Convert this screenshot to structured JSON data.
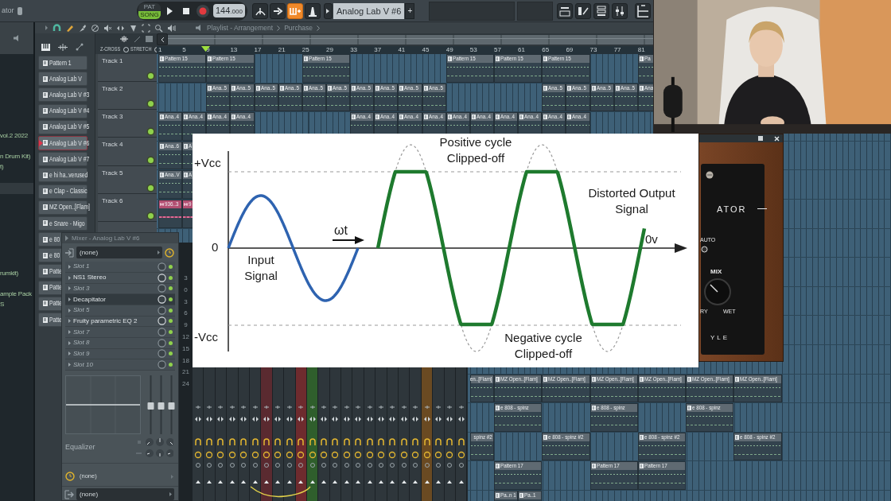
{
  "toolbar": {
    "panel_label": "ator",
    "mode": [
      {
        "label": "PAT",
        "selected": false
      },
      {
        "label": "SONG",
        "selected": true
      }
    ],
    "tempo": "144",
    "tempo_fraction": ".000",
    "buttons": [
      {
        "kind": "blend",
        "on": false
      },
      {
        "kind": "arrow",
        "on": false
      },
      {
        "kind": "typing",
        "on": true
      },
      {
        "kind": "metronome",
        "on": false
      }
    ],
    "pattern": "Analog Lab V #6",
    "add_label": "+"
  },
  "browser": {
    "groups": [
      [
        "vol.2 2022",
        "n Drum Kit)",
        "t)"
      ],
      [
        "rumkit)",
        "ample Pack",
        "S"
      ]
    ]
  },
  "playlist": {
    "breadcrumbs": [
      "Playlist - Arrangement",
      "Purchase"
    ],
    "stretch_labels": [
      "Z-CROSS",
      "STRETCH"
    ],
    "ruler": [
      "1",
      "5",
      "9",
      "13",
      "17",
      "21",
      "25",
      "29",
      "33",
      "37",
      "41",
      "45",
      "49",
      "53",
      "57",
      "61",
      "65",
      "69",
      "73",
      "77",
      "81"
    ]
  },
  "channels": [
    {
      "label": "Pattern 1",
      "selected": false
    },
    {
      "label": "Analog Lab V",
      "selected": false
    },
    {
      "label": "Analog Lab V #3",
      "selected": false
    },
    {
      "label": "Analog Lab V #4",
      "selected": false
    },
    {
      "label": "Analog Lab V #5",
      "selected": false
    },
    {
      "label": "Analog Lab V #6",
      "selected": true
    },
    {
      "label": "Analog Lab V #7",
      "selected": false
    },
    {
      "label": "e hi ha..verused",
      "selected": false
    },
    {
      "label": "e Clap - Classic",
      "selected": false
    },
    {
      "label": "MZ Open..[Flam]",
      "selected": false
    },
    {
      "label": "e Snare - Migo",
      "selected": false
    },
    {
      "label": "e 80",
      "selected": false
    },
    {
      "label": "e 80",
      "selected": false
    },
    {
      "label": "Patte",
      "selected": false
    },
    {
      "label": "Patte",
      "selected": false
    },
    {
      "label": "Patte",
      "selected": false
    },
    {
      "label": "Patte",
      "selected": false
    }
  ],
  "tracks": [
    {
      "name": "Track 1",
      "enabled": true,
      "segments": [
        {
          "kind": "pattern",
          "label": "Pattern 15",
          "wide": true
        },
        {
          "kind": "pattern",
          "label": "Pattern 15",
          "wide": true
        },
        {
          "kind": "gap"
        },
        {
          "kind": "gap"
        },
        {
          "kind": "pattern",
          "label": "Pattern 15",
          "wide": true
        },
        {
          "kind": "gap"
        },
        {
          "kind": "gap"
        },
        {
          "kind": "gap"
        },
        {
          "kind": "gap"
        },
        {
          "kind": "pattern",
          "label": "Pattern 15",
          "wide": true
        },
        {
          "kind": "pattern",
          "label": "Pattern 15",
          "wide": true
        },
        {
          "kind": "pattern",
          "label": "Pattern 15",
          "wide": true
        },
        {
          "kind": "gap"
        },
        {
          "kind": "gap"
        },
        {
          "kind": "pattern",
          "label": "Pa",
          "wide": false
        }
      ]
    },
    {
      "name": "Track 2",
      "enabled": true,
      "segments": [
        {
          "kind": "gap"
        },
        {
          "kind": "gap"
        },
        {
          "kind": "pattern",
          "label": "Ana..5",
          "wide": false
        },
        {
          "kind": "pattern",
          "label": "Ana..5",
          "wide": false
        },
        {
          "kind": "pattern",
          "label": "Ana..5",
          "wide": false
        },
        {
          "kind": "pattern",
          "label": "Ana..5",
          "wide": false
        },
        {
          "kind": "pattern",
          "label": "Ana..5",
          "wide": false
        },
        {
          "kind": "pattern",
          "label": "Ana..5",
          "wide": false
        },
        {
          "kind": "pattern",
          "label": "Ana..5",
          "wide": false
        },
        {
          "kind": "pattern",
          "label": "Ana..5",
          "wide": false
        },
        {
          "kind": "pattern",
          "label": "Ana..5",
          "wide": false
        },
        {
          "kind": "pattern",
          "label": "Ana..5",
          "wide": false
        },
        {
          "kind": "gap"
        },
        {
          "kind": "gap"
        },
        {
          "kind": "gap"
        },
        {
          "kind": "gap"
        },
        {
          "kind": "pattern",
          "label": "Ana..5",
          "wide": false
        },
        {
          "kind": "pattern",
          "label": "Ana..5",
          "wide": false
        },
        {
          "kind": "pattern",
          "label": "Ana..5",
          "wide": false
        },
        {
          "kind": "pattern",
          "label": "Ana..5",
          "wide": false
        },
        {
          "kind": "pattern",
          "label": "Ana",
          "wide": false
        }
      ]
    },
    {
      "name": "Track 3",
      "enabled": true,
      "segments": [
        {
          "kind": "pattern",
          "label": "Ana..4",
          "wide": false
        },
        {
          "kind": "pattern",
          "label": "Ana..4",
          "wide": false
        },
        {
          "kind": "pattern",
          "label": "Ana..4",
          "wide": false
        },
        {
          "kind": "pattern",
          "label": "Ana..4",
          "wide": false
        },
        {
          "kind": "gap"
        },
        {
          "kind": "gap"
        },
        {
          "kind": "gap"
        },
        {
          "kind": "gap"
        },
        {
          "kind": "pattern",
          "label": "Ana..4",
          "wide": false
        },
        {
          "kind": "pattern",
          "label": "Ana..4",
          "wide": false
        },
        {
          "kind": "pattern",
          "label": "Ana..4",
          "wide": false
        },
        {
          "kind": "pattern",
          "label": "Ana..4",
          "wide": false
        },
        {
          "kind": "pattern",
          "label": "Ana..4",
          "wide": false
        },
        {
          "kind": "pattern",
          "label": "Ana..4",
          "wide": false
        },
        {
          "kind": "pattern",
          "label": "Ana..4",
          "wide": false
        },
        {
          "kind": "pattern",
          "label": "Ana..4",
          "wide": false
        },
        {
          "kind": "pattern",
          "label": "Ana..4",
          "wide": false
        },
        {
          "kind": "pattern",
          "label": "Ana..4",
          "wide": false
        }
      ]
    },
    {
      "name": "Track 4",
      "enabled": true,
      "segments": [
        {
          "kind": "pattern",
          "label": "Ana..6",
          "wide": false
        },
        {
          "kind": "pattern",
          "label": "A",
          "wide": false
        }
      ]
    },
    {
      "name": "Track 5",
      "enabled": true,
      "segments": [
        {
          "kind": "pattern",
          "label": "Ana..V",
          "wide": false
        },
        {
          "kind": "pattern",
          "label": "A",
          "wide": false
        }
      ]
    },
    {
      "name": "Track 6",
      "enabled": true,
      "segments": [
        {
          "kind": "audio",
          "label": "936..3",
          "wide": false
        },
        {
          "kind": "audio",
          "label": "9",
          "wide": false
        }
      ]
    }
  ],
  "lower_tracks": [
    {
      "segments": [
        {
          "kind": "gap"
        },
        {
          "kind": "gap"
        },
        {
          "kind": "gap"
        },
        {
          "kind": "gap"
        },
        {
          "kind": "gap"
        },
        {
          "kind": "gap"
        },
        {
          "kind": "gap"
        },
        {
          "kind": "gap"
        },
        {
          "kind": "gap"
        },
        {
          "kind": "gap"
        },
        {
          "kind": "gap"
        },
        {
          "kind": "gap"
        },
        {
          "kind": "gap"
        },
        {
          "kind": "cut",
          "label": "en..[Flam]",
          "wide": false
        },
        {
          "kind": "pattern",
          "label": "MZ Open..[Flam]",
          "wide": true
        },
        {
          "kind": "pattern",
          "label": "MZ Open..[Flam]",
          "wide": true
        },
        {
          "kind": "pattern",
          "label": "MZ Open..[Flam]",
          "wide": true
        },
        {
          "kind": "pattern",
          "label": "MZ Open..[Flam]",
          "wide": true
        },
        {
          "kind": "pattern",
          "label": "MZ Open..[Flam]",
          "wide": true
        },
        {
          "kind": "pattern",
          "label": "MZ Open..[Flam]",
          "wide": true
        }
      ]
    },
    {
      "segments": [
        {
          "kind": "gap"
        },
        {
          "kind": "gap"
        },
        {
          "kind": "gap"
        },
        {
          "kind": "gap"
        },
        {
          "kind": "gap"
        },
        {
          "kind": "gap"
        },
        {
          "kind": "gap"
        },
        {
          "kind": "gap"
        },
        {
          "kind": "gap"
        },
        {
          "kind": "gap"
        },
        {
          "kind": "gap"
        },
        {
          "kind": "gap"
        },
        {
          "kind": "gap"
        },
        {
          "kind": "gap"
        },
        {
          "kind": "pattern",
          "label": "e 808 - spinz",
          "wide": true
        },
        {
          "kind": "gap"
        },
        {
          "kind": "gap"
        },
        {
          "kind": "pattern",
          "label": "e 808 - spinz",
          "wide": true
        },
        {
          "kind": "gap"
        },
        {
          "kind": "gap"
        },
        {
          "kind": "pattern",
          "label": "e 808 - spinz",
          "wide": true
        }
      ]
    },
    {
      "segments": [
        {
          "kind": "gap"
        },
        {
          "kind": "gap"
        },
        {
          "kind": "gap"
        },
        {
          "kind": "gap"
        },
        {
          "kind": "gap"
        },
        {
          "kind": "gap"
        },
        {
          "kind": "gap"
        },
        {
          "kind": "gap"
        },
        {
          "kind": "gap"
        },
        {
          "kind": "gap"
        },
        {
          "kind": "gap"
        },
        {
          "kind": "gap"
        },
        {
          "kind": "gap"
        },
        {
          "kind": "cut",
          "label": "spinz #2",
          "wide": false
        },
        {
          "kind": "gap"
        },
        {
          "kind": "gap"
        },
        {
          "kind": "pattern",
          "label": "e 808 - spinz #2",
          "wide": true
        },
        {
          "kind": "gap"
        },
        {
          "kind": "gap"
        },
        {
          "kind": "pattern",
          "label": "e 808 - spinz #2",
          "wide": true
        },
        {
          "kind": "gap"
        },
        {
          "kind": "gap"
        },
        {
          "kind": "pattern",
          "label": "e 808 - spinz #2",
          "wide": true
        }
      ]
    },
    {
      "segments": [
        {
          "kind": "gap"
        },
        {
          "kind": "gap"
        },
        {
          "kind": "gap"
        },
        {
          "kind": "gap"
        },
        {
          "kind": "gap"
        },
        {
          "kind": "gap"
        },
        {
          "kind": "gap"
        },
        {
          "kind": "gap"
        },
        {
          "kind": "gap"
        },
        {
          "kind": "gap"
        },
        {
          "kind": "gap"
        },
        {
          "kind": "gap"
        },
        {
          "kind": "gap"
        },
        {
          "kind": "gap"
        },
        {
          "kind": "pattern",
          "label": "Pattern 17",
          "wide": true
        },
        {
          "kind": "gap"
        },
        {
          "kind": "gap"
        },
        {
          "kind": "pattern",
          "label": "Pattern 17",
          "wide": true
        },
        {
          "kind": "pattern",
          "label": "Pattern 17",
          "wide": true
        }
      ]
    },
    {
      "segments": [
        {
          "kind": "gap"
        },
        {
          "kind": "gap"
        },
        {
          "kind": "gap"
        },
        {
          "kind": "gap"
        },
        {
          "kind": "gap"
        },
        {
          "kind": "gap"
        },
        {
          "kind": "gap"
        },
        {
          "kind": "gap"
        },
        {
          "kind": "gap"
        },
        {
          "kind": "gap"
        },
        {
          "kind": "gap"
        },
        {
          "kind": "gap"
        },
        {
          "kind": "gap"
        },
        {
          "kind": "gap"
        },
        {
          "kind": "pattern",
          "label": "Pa..n 1",
          "wide": false
        },
        {
          "kind": "pattern",
          "label": "Pa..1",
          "wide": false
        }
      ]
    }
  ],
  "mixer": {
    "title": "Mixer - Analog Lab V #6",
    "input": "(none)",
    "slots": [
      {
        "label": "Slot 1",
        "empty": true,
        "selected": false,
        "on": true
      },
      {
        "label": "NS1 Stereo",
        "empty": false,
        "selected": false,
        "on": true
      },
      {
        "label": "Slot 3",
        "empty": true,
        "selected": false,
        "on": true
      },
      {
        "label": "Decapitator",
        "empty": false,
        "selected": true,
        "on": true
      },
      {
        "label": "Slot 5",
        "empty": true,
        "selected": false,
        "on": true
      },
      {
        "label": "Fruity parametric EQ 2",
        "empty": false,
        "selected": false,
        "on": true
      },
      {
        "label": "Slot 7",
        "empty": true,
        "selected": false,
        "on": true
      },
      {
        "label": "Slot 8",
        "empty": true,
        "selected": false,
        "on": true
      },
      {
        "label": "Slot 9",
        "empty": true,
        "selected": false,
        "on": true
      },
      {
        "label": "Slot 10",
        "empty": true,
        "selected": false,
        "on": true
      }
    ],
    "eq_label": "Equalizer",
    "send": "(none)",
    "output": "(none)",
    "meter_scale": [
      "3",
      "0",
      "3",
      "6",
      "9",
      "12",
      "15",
      "18",
      "21",
      "24"
    ],
    "strips": [
      {
        "color": "#2e363b"
      },
      {
        "color": "#2e363b"
      },
      {
        "color": "#2e363b"
      },
      {
        "color": "#2e363b"
      },
      {
        "color": "#2e363b"
      },
      {
        "color": "#2e363b"
      },
      {
        "color": "#5a2a30"
      },
      {
        "color": "#2e363b"
      },
      {
        "color": "#2e363b"
      },
      {
        "color": "#6e2b2e"
      },
      {
        "color": "#2f5e2c"
      },
      {
        "color": "#2e363b"
      },
      {
        "color": "#2e363b"
      },
      {
        "color": "#2e363b"
      },
      {
        "color": "#2e363b"
      },
      {
        "color": "#2e363b"
      },
      {
        "color": "#2e363b"
      },
      {
        "color": "#2e363b"
      },
      {
        "color": "#2e363b"
      },
      {
        "color": "#2e363b"
      },
      {
        "color": "#6a4a22"
      },
      {
        "color": "#2e363b"
      },
      {
        "color": "#2e363b"
      },
      {
        "color": "#2e363b"
      }
    ]
  },
  "diagram": {
    "vcc_positive": "+Vcc",
    "zero": "0",
    "vcc_negative": "-Vcc",
    "input": "Input Signal",
    "omega": "ωt",
    "positive_clip": "Positive cycle Clipped-off",
    "output": "Distorted Output Signal",
    "zero_v": "0v",
    "negative_clip": "Negative cycle Clipped-off"
  },
  "plugin": {
    "name_fragment": "ATOR",
    "auto": "AUTO",
    "mix": "MIX",
    "dry": "RY",
    "wet": "WET",
    "footer": "YLE"
  }
}
